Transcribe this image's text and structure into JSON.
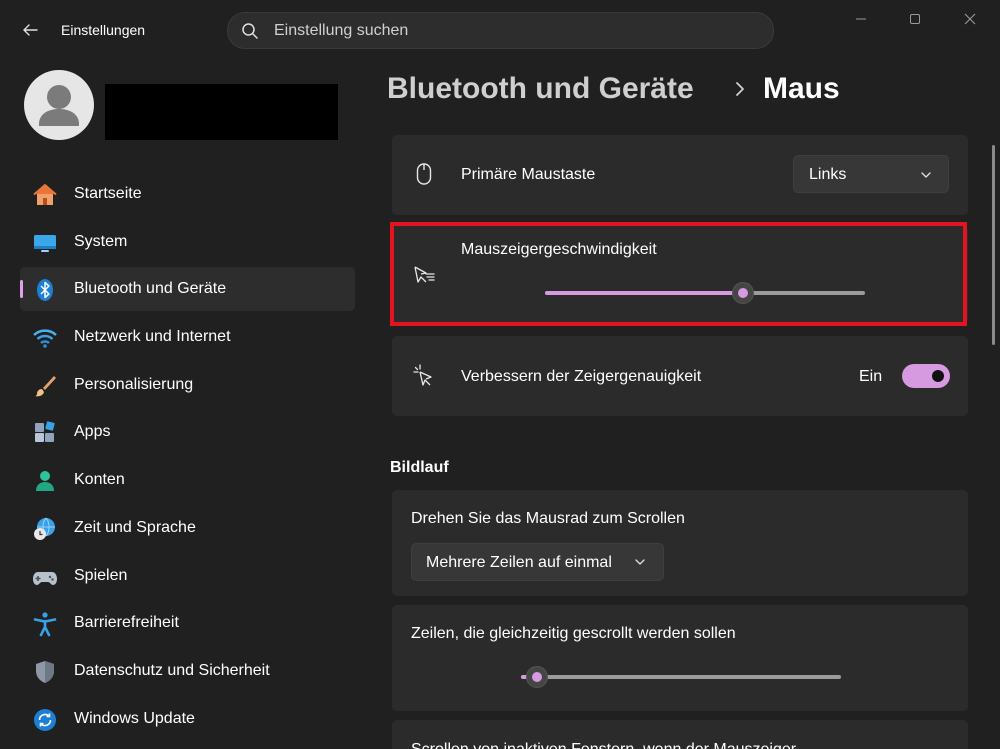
{
  "titlebar": {
    "app_title": "Einstellungen",
    "search_placeholder": "Einstellung suchen"
  },
  "breadcrumb": {
    "parent": "Bluetooth und Geräte",
    "current": "Maus"
  },
  "sidebar": {
    "items": [
      {
        "label": "Startseite",
        "icon": "home-icon"
      },
      {
        "label": "System",
        "icon": "monitor-icon"
      },
      {
        "label": "Bluetooth und Geräte",
        "icon": "bluetooth-icon",
        "active": true
      },
      {
        "label": "Netzwerk und Internet",
        "icon": "wifi-icon"
      },
      {
        "label": "Personalisierung",
        "icon": "paintbrush-icon"
      },
      {
        "label": "Apps",
        "icon": "apps-icon"
      },
      {
        "label": "Konten",
        "icon": "account-icon"
      },
      {
        "label": "Zeit und Sprache",
        "icon": "globe-clock-icon"
      },
      {
        "label": "Spielen",
        "icon": "gamepad-icon"
      },
      {
        "label": "Barrierefreiheit",
        "icon": "accessibility-icon"
      },
      {
        "label": "Datenschutz und Sicherheit",
        "icon": "shield-icon"
      },
      {
        "label": "Windows Update",
        "icon": "update-icon"
      }
    ]
  },
  "settings": {
    "primary_button": {
      "label": "Primäre Maustaste",
      "value": "Links"
    },
    "pointer_speed": {
      "label": "Mauszeigergeschwindigkeit",
      "value_fraction": 0.62
    },
    "precision": {
      "label": "Verbessern der Zeigergenauigkeit",
      "state": "Ein",
      "on": true
    },
    "scroll_section": "Bildlauf",
    "scroll_mode": {
      "label": "Drehen Sie das Mausrad zum Scrollen",
      "value": "Mehrere Zeilen auf einmal"
    },
    "scroll_lines": {
      "label": "Zeilen, die gleichzeitig gescrollt werden sollen",
      "value_fraction": 0.05
    },
    "next_card_partial": "Scrollen von inaktiven Fenstern, wenn der Mauszeiger"
  },
  "colors": {
    "accent": "#d59ae0",
    "highlight_border": "#e3131f",
    "background": "#202020",
    "card": "#2b2b2b"
  }
}
